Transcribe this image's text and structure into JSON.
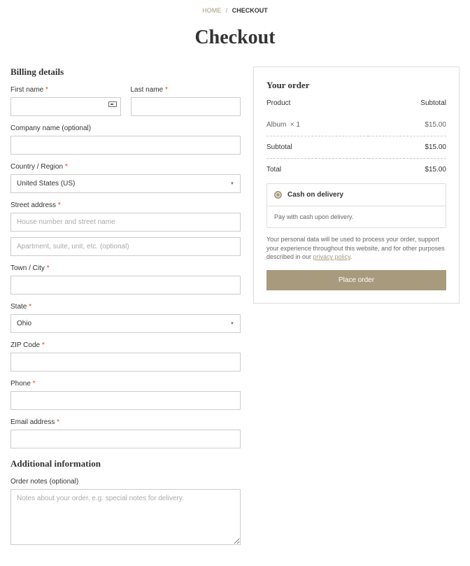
{
  "breadcrumb": {
    "home": "HOME",
    "current": "CHECKOUT"
  },
  "page_title": "Checkout",
  "billing": {
    "heading": "Billing details",
    "first_name": "First name",
    "last_name": "Last name",
    "company": "Company name (optional)",
    "country": "Country / Region",
    "country_value": "United States (US)",
    "street": "Street address",
    "street_ph1": "House number and street name",
    "street_ph2": "Apartment, suite, unit, etc. (optional)",
    "city": "Town / City",
    "state": "State",
    "state_value": "Ohio",
    "zip": "ZIP Code",
    "phone": "Phone",
    "email": "Email address"
  },
  "additional": {
    "heading": "Additional information",
    "notes_label": "Order notes (optional)",
    "notes_ph": "Notes about your order, e.g. special notes for delivery."
  },
  "order": {
    "heading": "Your order",
    "product_h": "Product",
    "subtotal_h": "Subtotal",
    "item_name": "Album",
    "item_qty": "× 1",
    "item_price": "$15.00",
    "sub_label": "Subtotal",
    "sub_val": "$15.00",
    "total_label": "Total",
    "total_val": "$15.00",
    "pay_method": "Cash on delivery",
    "pay_desc": "Pay with cash upon delivery.",
    "privacy_pre": "Your personal data will be used to process your order, support your experience throughout this website, and for other purposes described in our ",
    "privacy_link": "privacy policy",
    "place_btn": "Place order"
  }
}
